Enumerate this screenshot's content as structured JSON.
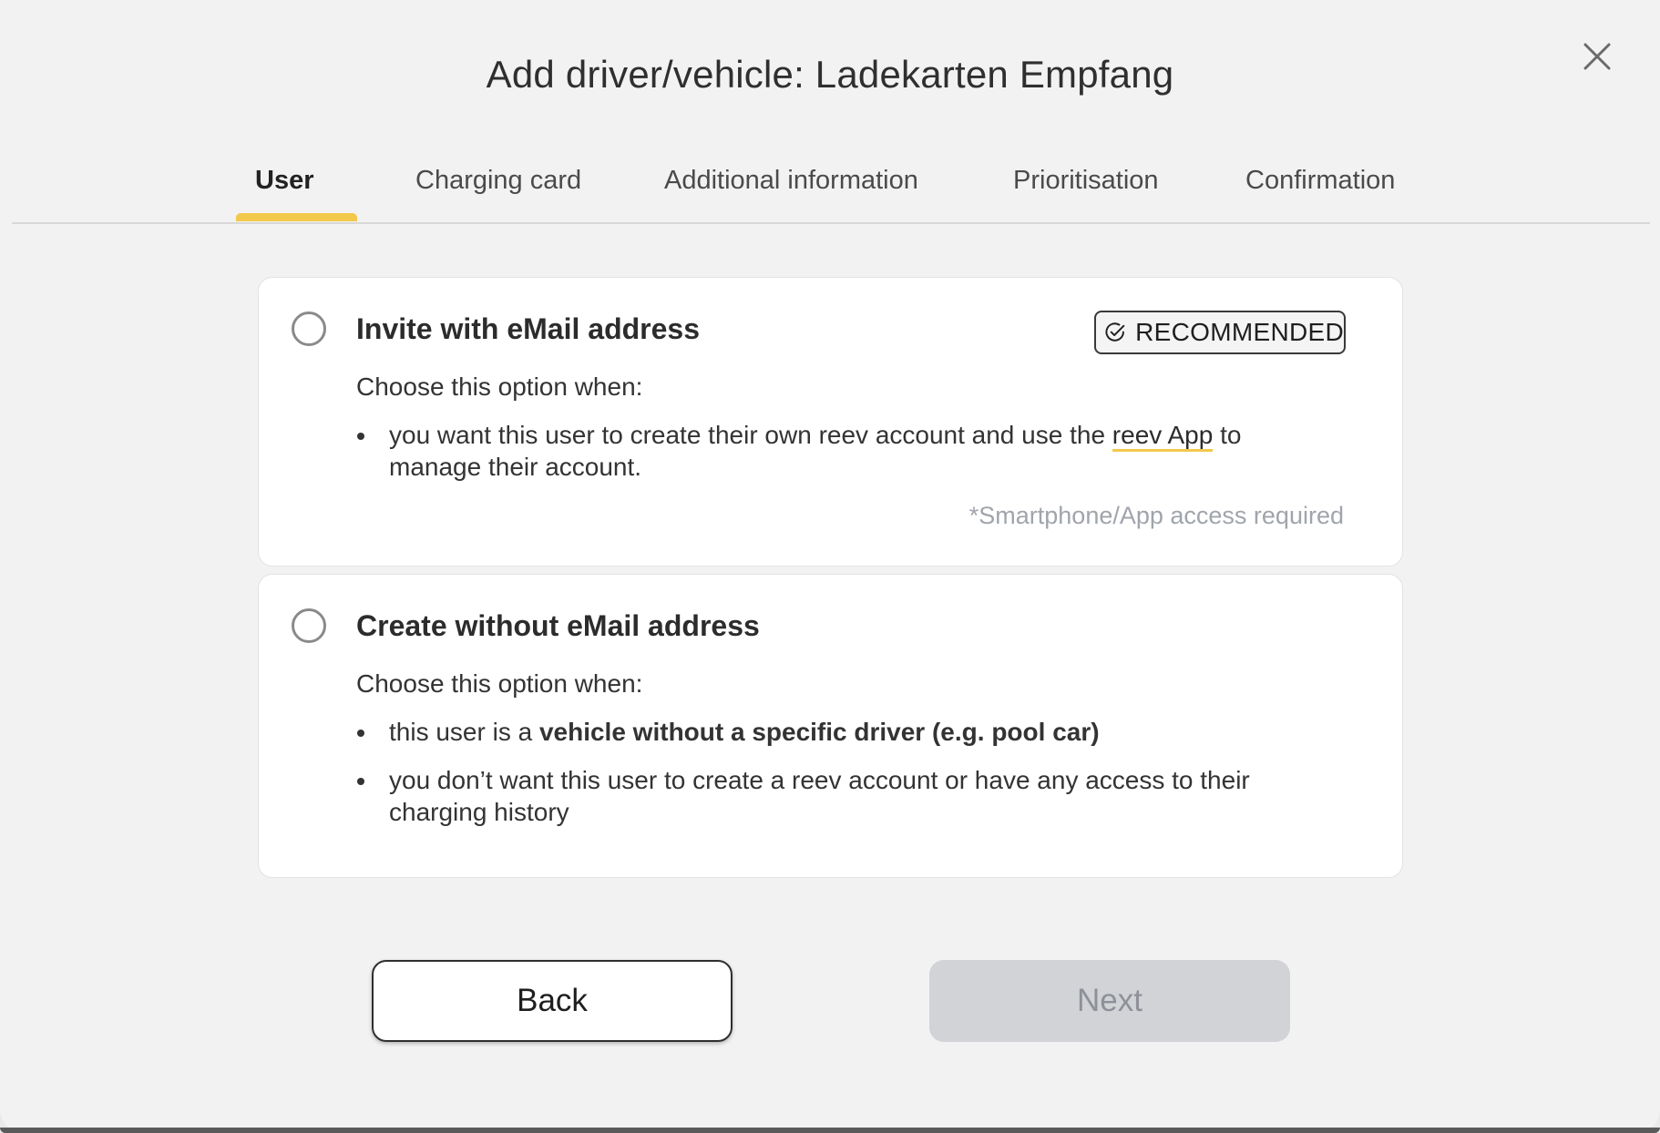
{
  "dialog": {
    "title": "Add driver/vehicle: Ladekarten Empfang",
    "close_icon": "close-icon"
  },
  "tabs": [
    {
      "label": "User",
      "active": true
    },
    {
      "label": "Charging card",
      "active": false
    },
    {
      "label": "Additional information",
      "active": false
    },
    {
      "label": "Prioritisation",
      "active": false
    },
    {
      "label": "Confirmation",
      "active": false
    }
  ],
  "options": {
    "invite": {
      "title": "Invite with eMail address",
      "selected": false,
      "badge": {
        "icon": "check-circle-icon",
        "label": "RECOMMENDED"
      },
      "subtitle": "Choose this option when:",
      "bullet1": {
        "before": "you want this user to create their own reev account and use the ",
        "link": "reev App",
        "after": " to manage their account."
      },
      "note": "*Smartphone/App access required"
    },
    "create": {
      "title": "Create without eMail address",
      "selected": false,
      "subtitle": "Choose this option when:",
      "bullet1": {
        "before": "this user is a ",
        "strong": "vehicle without a specific driver (e.g. pool car)"
      },
      "bullet2": "you don’t want this user to create a reev account or have any access to their charging history"
    }
  },
  "footer": {
    "back_label": "Back",
    "next_label": "Next",
    "next_enabled": false
  },
  "colors": {
    "accent": "#f3c94b",
    "background": "#f2f2f2",
    "disabled_button": "#d1d3d7",
    "note_text": "#a0a4ab"
  }
}
